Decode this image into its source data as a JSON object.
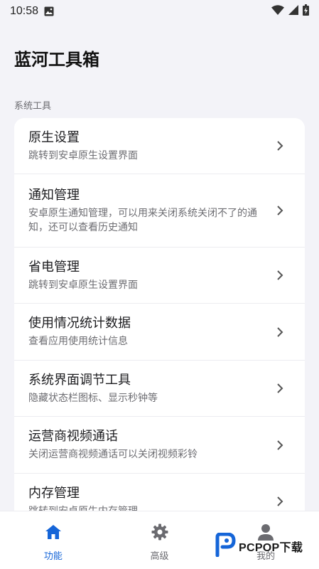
{
  "status_bar": {
    "time": "10:58",
    "icons": [
      "gallery-icon",
      "wifi-icon",
      "signal-icon",
      "battery-charging-icon"
    ]
  },
  "app": {
    "title": "蓝河工具箱"
  },
  "section": {
    "label": "系统工具"
  },
  "tools": [
    {
      "title": "原生设置",
      "desc": "跳转到安卓原生设置界面"
    },
    {
      "title": "通知管理",
      "desc": "安卓原生通知管理，可以用来关闭系统关闭不了的通知，还可以查看历史通知"
    },
    {
      "title": "省电管理",
      "desc": "跳转到安卓原生设置界面"
    },
    {
      "title": "使用情况统计数据",
      "desc": "查看应用使用统计信息"
    },
    {
      "title": "系统界面调节工具",
      "desc": "隐藏状态栏图标、显示秒钟等"
    },
    {
      "title": "运营商视频通话",
      "desc": "关闭运营商视频通话可以关闭视频彩铃"
    },
    {
      "title": "内存管理",
      "desc": "跳转到安卓原生内存管理"
    }
  ],
  "bottom_nav": [
    {
      "label": "功能",
      "icon": "home-icon",
      "active": true
    },
    {
      "label": "高级",
      "icon": "gear-icon",
      "active": false
    },
    {
      "label": "我的",
      "icon": "person-icon",
      "active": false
    }
  ],
  "colors": {
    "accent": "#1565d8",
    "background": "#f3f3f8",
    "card": "#ffffff"
  },
  "watermark": {
    "text": "PCPOP下载"
  }
}
